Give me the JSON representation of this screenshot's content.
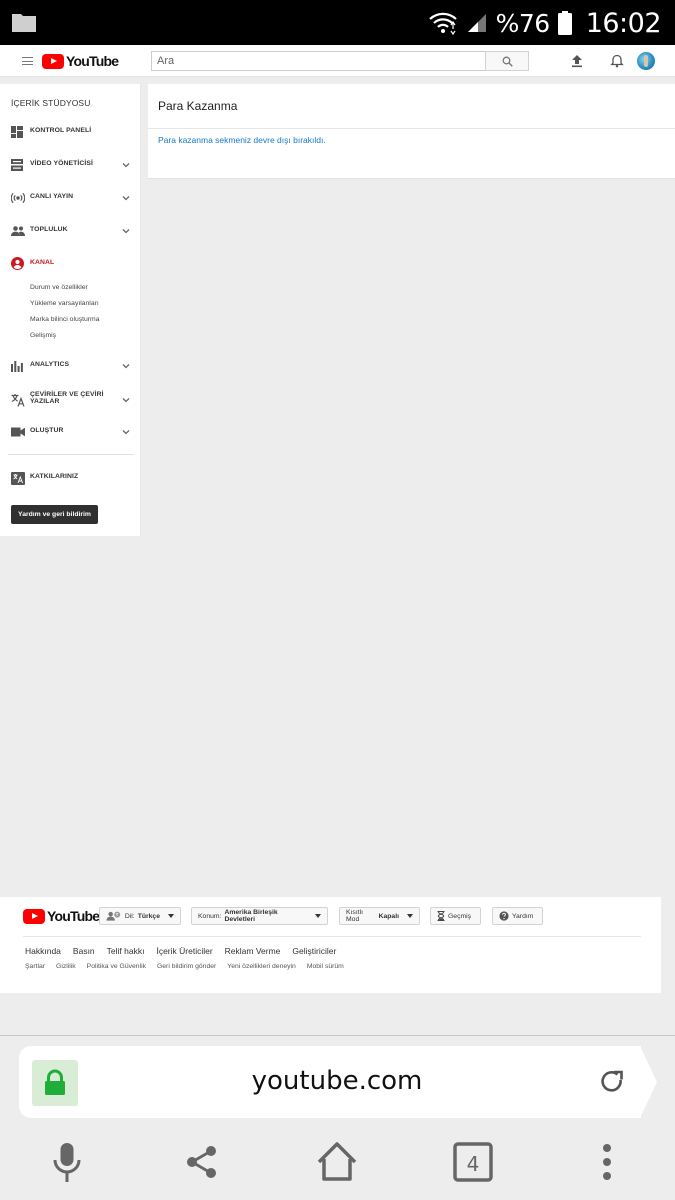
{
  "status_bar": {
    "battery_text": "%76",
    "time": "16:02"
  },
  "header": {
    "logo_text": "YouTube",
    "search_placeholder": "Ara"
  },
  "sidebar": {
    "title": "İÇERİK STÜDYOSU",
    "items": [
      {
        "label": "KONTROL PANELİ",
        "icon": "dashboard-icon",
        "expandable": false
      },
      {
        "label": "VİDEO YÖNETİCİSİ",
        "icon": "video-manager-icon",
        "expandable": true
      },
      {
        "label": "CANLI YAYIN",
        "icon": "live-broadcast-icon",
        "expandable": true
      },
      {
        "label": "TOPLULUK",
        "icon": "community-icon",
        "expandable": true
      },
      {
        "label": "KANAL",
        "icon": "channel-icon",
        "expandable": false,
        "active": true
      },
      {
        "label": "ANALYTICS",
        "icon": "analytics-icon",
        "expandable": true
      },
      {
        "label": "ÇEVİRİLER VE ÇEVİRİ YAZILAR",
        "icon": "translate-icon",
        "expandable": true
      },
      {
        "label": "OLUŞTUR",
        "icon": "create-video-icon",
        "expandable": true
      },
      {
        "label": "KATKILARINIZ",
        "icon": "contributions-icon",
        "expandable": false
      }
    ],
    "sub_items": [
      "Durum ve özellikler",
      "Yükleme varsayılanları",
      "Marka bilinci oluşturma",
      "Gelişmiş"
    ],
    "help_button": "Yardım ve geri bildirim"
  },
  "main": {
    "title": "Para Kazanma",
    "message": "Para kazanma sekmeniz devre dışı bırakıldı."
  },
  "footer": {
    "logo_text": "YouTube",
    "language_label": "Dil:",
    "language_value": "Türkçe",
    "location_label": "Konum:",
    "location_value": "Amerika Birleşik Devletleri",
    "restricted_label": "Kısıtlı Mod",
    "restricted_value": "Kapalı",
    "history": "Geçmiş",
    "help": "Yardım",
    "primary_links": [
      "Hakkında",
      "Basın",
      "Telif hakkı",
      "İçerik Üreticiler",
      "Reklam Verme",
      "Geliştiriciler"
    ],
    "secondary_links": [
      "Şartlar",
      "Gizlilik",
      "Politika ve Güvenlik",
      "Geri bildirim gönder",
      "Yeni özellikleri deneyin",
      "Mobil sürüm"
    ]
  },
  "browser": {
    "url": "youtube.com",
    "tab_count": "4"
  },
  "colors": {
    "youtube_red": "#ff0000",
    "active_red": "#cc181e",
    "link_blue": "#167ac6",
    "lock_green": "#1fae3a"
  }
}
